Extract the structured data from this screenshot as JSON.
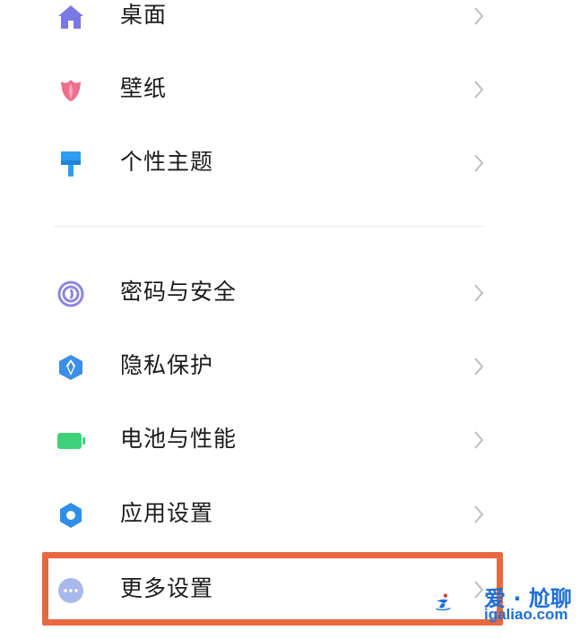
{
  "settings": {
    "group1": [
      {
        "label": "桌面",
        "icon": "home-icon"
      },
      {
        "label": "壁纸",
        "icon": "tulip-icon"
      },
      {
        "label": "个性主题",
        "icon": "paint-brush-icon"
      }
    ],
    "group2": [
      {
        "label": "密码与安全",
        "icon": "fingerprint-icon"
      },
      {
        "label": "隐私保护",
        "icon": "shield-icon"
      },
      {
        "label": "电池与性能",
        "icon": "battery-icon"
      },
      {
        "label": "应用设置",
        "icon": "gear-icon"
      },
      {
        "label": "更多设置",
        "icon": "more-dots-icon"
      }
    ]
  },
  "colors": {
    "home": "#7a78e6",
    "tulip": "#ee6e8c",
    "brush": "#2f9cf0",
    "fingerprint": "#8e86e0",
    "shield": "#3c8fe6",
    "battery": "#3fd17a",
    "gear": "#2f8fe8",
    "more": "#a9b8ea",
    "highlight": "#e9683f"
  },
  "watermark": {
    "title": "爱 · 尬聊",
    "url": "igaliao.com"
  }
}
